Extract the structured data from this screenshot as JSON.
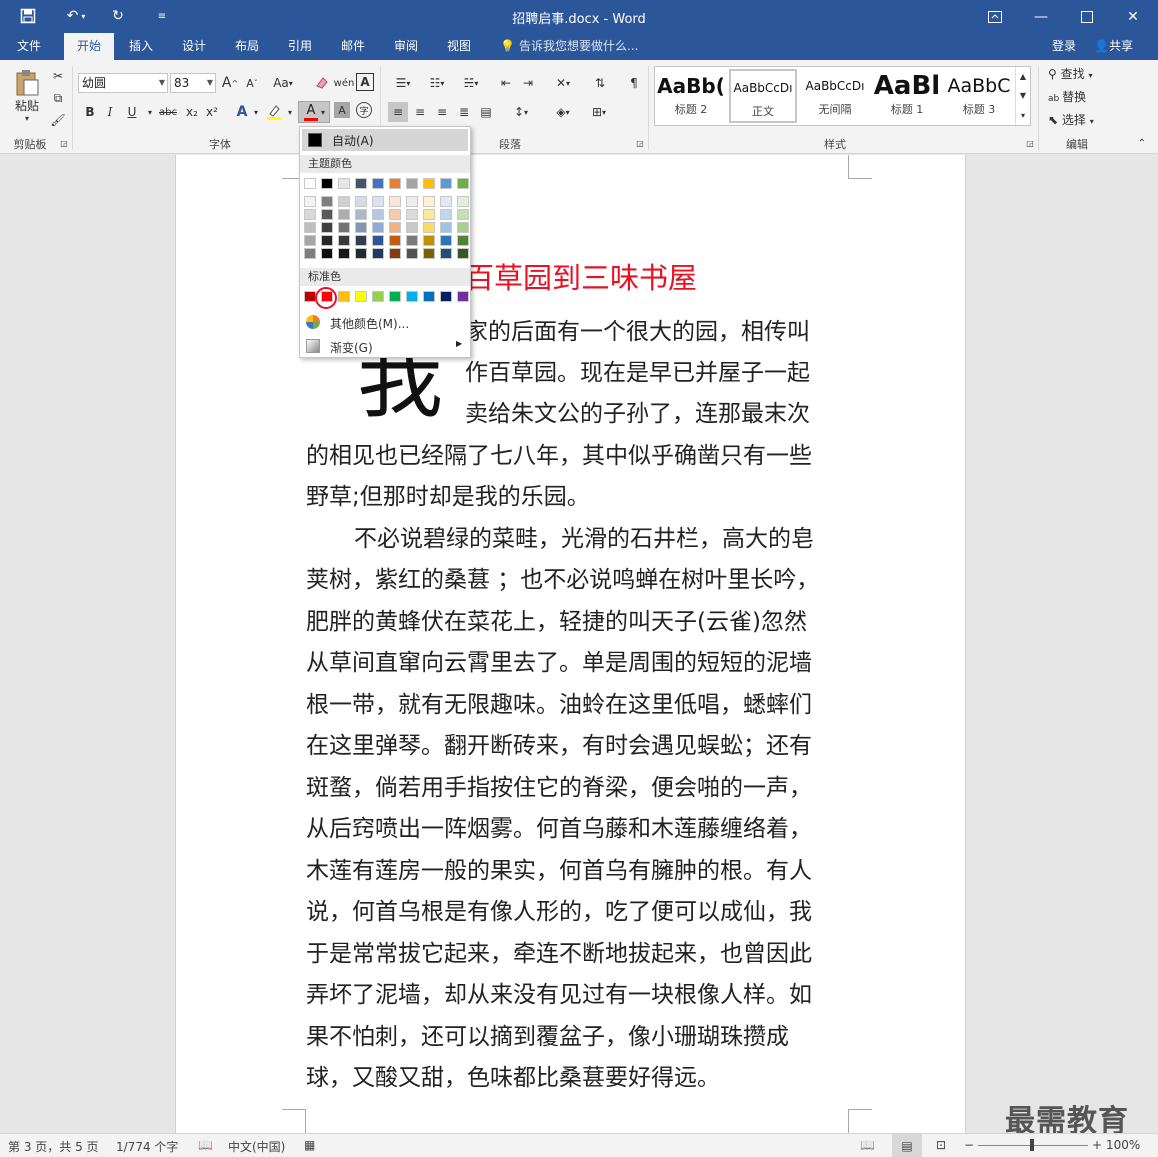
{
  "app": {
    "title": "招聘启事.docx - Word",
    "quick_access": {
      "undo_label": "↶",
      "redo_label": "↻"
    }
  },
  "tabs": [
    {
      "label": "文件"
    },
    {
      "label": "开始"
    },
    {
      "label": "插入"
    },
    {
      "label": "设计"
    },
    {
      "label": "布局"
    },
    {
      "label": "引用"
    },
    {
      "label": "邮件"
    },
    {
      "label": "审阅"
    },
    {
      "label": "视图"
    }
  ],
  "tell_me": "告诉我您想要做什么...",
  "account": {
    "login": "登录",
    "share": "共享"
  },
  "ribbon": {
    "clipboard": {
      "paste": "粘贴",
      "label": "剪贴板"
    },
    "font": {
      "name": "幼圆",
      "size": "83",
      "label": "字体",
      "grow": "A",
      "shrink": "A",
      "case": "Aa",
      "bold": "B",
      "italic": "I",
      "underline": "U",
      "strike": "abc",
      "sub": "x₂",
      "sup": "x²"
    },
    "paragraph": {
      "label": "段落"
    },
    "styles": {
      "label": "样式",
      "items": [
        {
          "preview": "AaBb(",
          "name": "标题 2"
        },
        {
          "preview": "AaBbCcDı",
          "name": "正文"
        },
        {
          "preview": "AaBbCcDı",
          "name": "无间隔"
        },
        {
          "preview": "AaBl",
          "name": "标题 1"
        },
        {
          "preview": "AaBbC",
          "name": "标题 3"
        }
      ]
    },
    "editing": {
      "find": "查找",
      "replace": "替换",
      "select": "选择",
      "label": "编辑"
    }
  },
  "color_menu": {
    "auto": "自动(A)",
    "theme_header": "主题颜色",
    "standard_header": "标准色",
    "more": "其他颜色(M)...",
    "gradient": "渐变(G)",
    "theme_top": [
      "#ffffff",
      "#000000",
      "#e7e6e6",
      "#44546a",
      "#4472c4",
      "#ed7d31",
      "#a5a5a5",
      "#ffc000",
      "#5b9bd5",
      "#70ad47"
    ],
    "theme_shades": [
      [
        "#f2f2f2",
        "#7f7f7f",
        "#d0cece",
        "#d6dce5",
        "#d9e2f3",
        "#fbe5d6",
        "#ededed",
        "#fff2cc",
        "#deebf7",
        "#e2f0d9"
      ],
      [
        "#d9d9d9",
        "#595959",
        "#aeabab",
        "#adb9ca",
        "#b4c7e7",
        "#f8cbad",
        "#dbdbdb",
        "#ffe699",
        "#bdd7ee",
        "#c5e0b4"
      ],
      [
        "#bfbfbf",
        "#3f3f3f",
        "#757171",
        "#8497b0",
        "#8faadc",
        "#f4b183",
        "#c9c9c9",
        "#ffd966",
        "#9dc3e6",
        "#a9d18e"
      ],
      [
        "#a6a6a6",
        "#262626",
        "#3b3838",
        "#333f50",
        "#2f5597",
        "#c55a11",
        "#7b7b7b",
        "#bf9000",
        "#2e75b6",
        "#548235"
      ],
      [
        "#7f7f7f",
        "#0d0d0d",
        "#171616",
        "#222a35",
        "#1f3864",
        "#843c0c",
        "#525252",
        "#7f6000",
        "#1f4e79",
        "#385723"
      ]
    ],
    "standard": [
      "#c00000",
      "#ff0000",
      "#ffc000",
      "#ffff00",
      "#92d050",
      "#00b050",
      "#00b0f0",
      "#0070c0",
      "#002060",
      "#7030a0"
    ]
  },
  "document": {
    "heading": "百草园到三味书屋",
    "dropcap": "我",
    "lines": [
      "家的后面有一个很大的园，相传叫",
      "作百草园。现在是早已并屋子一起",
      "卖给朱文公的子孙了，连那最末次",
      "的相见也已经隔了七八年，其中似乎确凿只有一些",
      "野草;但那时却是我的乐园。",
      "不必说碧绿的菜畦，光滑的石井栏，高大的皂",
      "荚树，紫红的桑葚 ；也不必说鸣蝉在树叶里长吟，",
      "肥胖的黄蜂伏在菜花上，轻捷的叫天子(云雀)忽然",
      "从草间直窜向云霄里去了。单是周围的短短的泥墙",
      "根一带，就有无限趣味。油蛉在这里低唱，蟋蟀们",
      "在这里弹琴。翻开断砖来，有时会遇见蜈蚣；还有",
      "斑蝥，倘若用手指按住它的脊梁，便会啪的一声，",
      "从后窍喷出一阵烟雾。何首乌藤和木莲藤缠络着，",
      "木莲有莲房一般的果实，何首乌有臃肿的根。有人",
      "说，何首乌根是有像人形的，吃了便可以成仙，我",
      "于是常常拔它起来，牵连不断地拔起来，也曾因此",
      "弄坏了泥墙，却从来没有见过有一块根像人样。如",
      "果不怕刺，还可以摘到覆盆子，像小珊瑚珠攒成",
      "球，又酸又甜，色味都比桑葚要好得远。"
    ]
  },
  "status": {
    "page": "第 3 页，共 5 页",
    "words": "1/774 个字",
    "lang": "中文(中国)",
    "zoom": "100%"
  },
  "watermark": "最需教育"
}
